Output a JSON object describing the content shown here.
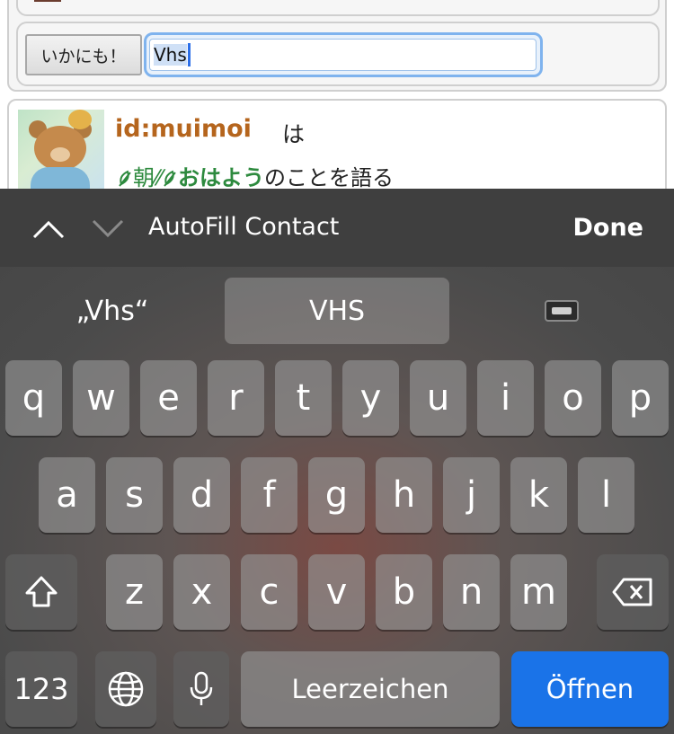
{
  "webpage": {
    "button_label": "いかにも！",
    "text_input_value": "Vhs",
    "entry_user": "id:muimoi",
    "entry_particle": "は",
    "keyword_1": "朝",
    "keyword_separator": "⁄⁄",
    "keyword_2": "おはよう",
    "entry_suffix": "のことを語る"
  },
  "accessory_bar": {
    "autofill_label": "AutoFill Contact",
    "done_label": "Done"
  },
  "keyboard": {
    "suggestions": [
      "„Vhs“",
      "VHS"
    ],
    "suggestion_emoji_icon": "videocassette-icon",
    "row1": [
      "q",
      "w",
      "e",
      "r",
      "t",
      "y",
      "u",
      "i",
      "o",
      "p"
    ],
    "row2": [
      "a",
      "s",
      "d",
      "f",
      "g",
      "h",
      "j",
      "k",
      "l"
    ],
    "row3": [
      "z",
      "x",
      "c",
      "v",
      "b",
      "n",
      "m"
    ],
    "numbers_key": "123",
    "space_key": "Leerzeichen",
    "return_key": "Öffnen",
    "accent_color": "#1a73e8"
  }
}
